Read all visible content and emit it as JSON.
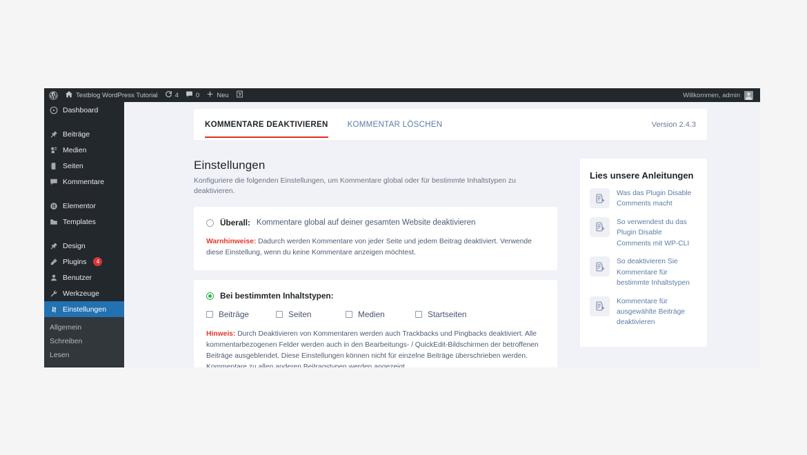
{
  "adminbar": {
    "wp_logo": "wordpress-logo-icon",
    "site_name": "Testblog WordPress Tutorial",
    "updates_icon": "updates-icon",
    "updates_count": "4",
    "comments_icon": "comment-bubble-icon",
    "comments_count": "0",
    "new_icon": "plus-icon",
    "new_label": "Neu",
    "seo_icon": "yoast-seo-icon",
    "greeting": "Willkommen, admin",
    "avatar": "user-avatar-icon"
  },
  "adminmenu": {
    "items": [
      {
        "label": "Dashboard",
        "icon": "dashboard-icon",
        "badge": "",
        "current": false,
        "sep_after": true
      },
      {
        "label": "Beiträge",
        "icon": "pin-icon",
        "badge": "",
        "current": false,
        "sep_after": false
      },
      {
        "label": "Medien",
        "icon": "media-icon",
        "badge": "",
        "current": false,
        "sep_after": false
      },
      {
        "label": "Seiten",
        "icon": "pages-icon",
        "badge": "",
        "current": false,
        "sep_after": false
      },
      {
        "label": "Kommentare",
        "icon": "comment-icon",
        "badge": "",
        "current": false,
        "sep_after": true
      },
      {
        "label": "Elementor",
        "icon": "elementor-icon",
        "badge": "",
        "current": false,
        "sep_after": false
      },
      {
        "label": "Templates",
        "icon": "templates-icon",
        "badge": "",
        "current": false,
        "sep_after": true
      },
      {
        "label": "Design",
        "icon": "appearance-icon",
        "badge": "",
        "current": false,
        "sep_after": false
      },
      {
        "label": "Plugins",
        "icon": "plugins-icon",
        "badge": "4",
        "current": false,
        "sep_after": false
      },
      {
        "label": "Benutzer",
        "icon": "users-icon",
        "badge": "",
        "current": false,
        "sep_after": false
      },
      {
        "label": "Werkzeuge",
        "icon": "tools-icon",
        "badge": "",
        "current": false,
        "sep_after": false
      },
      {
        "label": "Einstellungen",
        "icon": "settings-icon",
        "badge": "",
        "current": true,
        "sep_after": false
      }
    ],
    "submenu": [
      {
        "label": "Allgemein"
      },
      {
        "label": "Schreiben"
      },
      {
        "label": "Lesen"
      }
    ]
  },
  "tabs": {
    "items": [
      {
        "label": "KOMMENTARE DEAKTIVIEREN",
        "active": true
      },
      {
        "label": "KOMMENTAR LÖSCHEN",
        "active": false
      }
    ],
    "version": "Version 2.4.3"
  },
  "settings": {
    "title": "Einstellungen",
    "subtitle": "Konfiguriere die folgenden Einstellungen, um Kommentare global oder für bestimmte Inhaltstypen zu deaktivieren.",
    "option_everywhere": {
      "radio_state": "unchecked",
      "strong": "Überall:",
      "desc": "Kommentare global auf deiner gesamten Website deaktivieren",
      "note_lead": "Warnhinweise:",
      "note_body": " Dadurch werden Kommentare von jeder Seite und jedem Beitrag deaktiviert. Verwende diese Einstellung, wenn du keine Kommentare anzeigen möchtest."
    },
    "option_types": {
      "radio_state": "checked",
      "strong": "Bei bestimmten Inhaltstypen:",
      "checkboxes": [
        {
          "label": "Beiträge",
          "checked": false
        },
        {
          "label": "Seiten",
          "checked": false
        },
        {
          "label": "Medien",
          "checked": false
        },
        {
          "label": "Startseiten",
          "checked": false
        }
      ],
      "note_lead": "Hinweis:",
      "note_body": " Durch Deaktivieren von Kommentaren werden auch Trackbacks und Pingbacks deaktiviert. Alle kommentarbezogenen Felder werden auch in den Bearbeitungs- / QuickEdit-Bildschirmen der betroffenen Beiträge ausgeblendet. Diese Einstellungen können nicht für einzelne Beiträge überschrieben werden. Kommentare zu allen anderen Beitragstypen werden angezeigt."
    }
  },
  "guides": {
    "title": "Lies unsere Anleitungen",
    "items": [
      {
        "icon": "document-edit-icon",
        "text": "Was das Plugin Disable Comments macht"
      },
      {
        "icon": "document-edit-icon",
        "text": "So verwendest du das Plugin Disable Comments mit WP-CLI"
      },
      {
        "icon": "document-edit-icon",
        "text": "So deaktivieren Sie Kommentare für bestimmte Inhaltstypen"
      },
      {
        "icon": "document-edit-icon",
        "text": "Kommentare für ausgewählte Beiträge deaktivieren"
      }
    ]
  },
  "colors": {
    "admin_dark": "#23282d",
    "admin_submenu": "#32373c",
    "current_blue": "#2271b1",
    "accent_red": "#e02b20",
    "link_blue": "#5b7ca8",
    "radio_green": "#2bb24c",
    "page_bg": "#f1f2f7"
  }
}
